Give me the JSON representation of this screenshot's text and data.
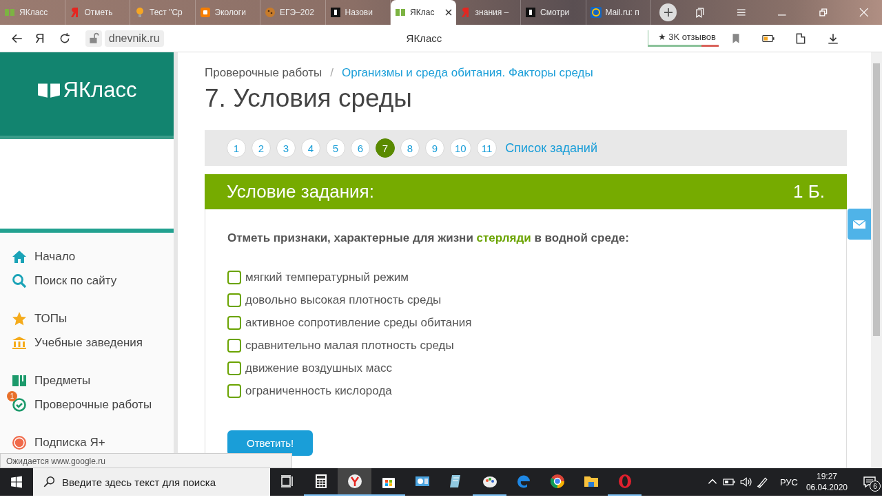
{
  "browser": {
    "tabs": [
      {
        "label": "ЯКласс",
        "selected": false
      },
      {
        "label": "Отметь",
        "selected": false
      },
      {
        "label": "Тест \"Ср",
        "selected": false
      },
      {
        "label": "Экологи",
        "selected": false
      },
      {
        "label": "ЕГЭ–202",
        "selected": false
      },
      {
        "label": "Назови",
        "selected": false
      },
      {
        "label": "ЯКлас",
        "selected": true
      },
      {
        "label": "знания –",
        "selected": false
      },
      {
        "label": "Смотри",
        "selected": false
      },
      {
        "label": "Mail.ru: п",
        "selected": false
      }
    ]
  },
  "address_bar": {
    "yandex_key": "Я",
    "url": "dnevnik.ru",
    "page_title": "ЯКласс",
    "reviews": "★ 3K отзывов"
  },
  "sidebar": {
    "logo": "ЯКласс",
    "sections": [
      [
        {
          "label": "Начало"
        },
        {
          "label": "Поиск по сайту"
        }
      ],
      [
        {
          "label": "ТОПы"
        },
        {
          "label": "Учебные заведения"
        }
      ],
      [
        {
          "label": "Предметы"
        },
        {
          "label": "Проверочные работы",
          "badge": "1"
        }
      ],
      [
        {
          "label": "Подписка Я+"
        }
      ]
    ]
  },
  "breadcrumb": {
    "parent": "Проверочные работы",
    "separator": "/",
    "current": "Организмы и среда обитания. Факторы среды"
  },
  "title": "7. Условия среды",
  "pager": {
    "items": [
      {
        "label": "1",
        "selected": false
      },
      {
        "label": "2",
        "selected": false
      },
      {
        "label": "3",
        "selected": false
      },
      {
        "label": "4",
        "selected": false
      },
      {
        "label": "5",
        "selected": false
      },
      {
        "label": "6",
        "selected": false
      },
      {
        "label": "7",
        "selected": true
      },
      {
        "label": "8",
        "selected": false
      },
      {
        "label": "9",
        "selected": false
      },
      {
        "label": "10",
        "selected": false
      },
      {
        "label": "11",
        "selected": false
      }
    ],
    "task_list": "Список заданий"
  },
  "task": {
    "header": "Условие задания:",
    "points": "1 Б.",
    "question": "Отметь признаки, характерные для жизни **стерляди** в водной среде:",
    "options": [
      {
        "label": "мягкий температурный режим",
        "checked": false
      },
      {
        "label": "довольно высокая плотность среды",
        "checked": false
      },
      {
        "label": "активное сопротивление среды обитания",
        "checked": false
      },
      {
        "label": "сравнительно малая плотность среды",
        "checked": false
      },
      {
        "label": "движение воздушных масс",
        "checked": false
      },
      {
        "label": "ограниченность кислорода",
        "checked": false
      }
    ],
    "submit": "Ответить!"
  },
  "status": "Ожидается www.google.ru",
  "taskbar": {
    "search_placeholder": "Введите здесь текст для поиска",
    "apps": [
      {
        "kind": "taskview",
        "running": false,
        "selected": false
      },
      {
        "kind": "calculator",
        "running": true,
        "selected": false
      },
      {
        "kind": "yandex",
        "running": true,
        "selected": true
      },
      {
        "kind": "store",
        "running": true,
        "selected": false
      },
      {
        "kind": "panel",
        "running": false,
        "selected": false
      },
      {
        "kind": "notepad",
        "running": false,
        "selected": false
      },
      {
        "kind": "paint",
        "running": true,
        "selected": false
      },
      {
        "kind": "edge",
        "running": false,
        "selected": false
      },
      {
        "kind": "chrome",
        "running": false,
        "selected": false
      },
      {
        "kind": "explorer",
        "running": false,
        "selected": false
      },
      {
        "kind": "opera",
        "running": true,
        "selected": false
      }
    ],
    "language": "РУС",
    "time": "19:27",
    "date": "06.04.2020",
    "notifications": "6"
  }
}
